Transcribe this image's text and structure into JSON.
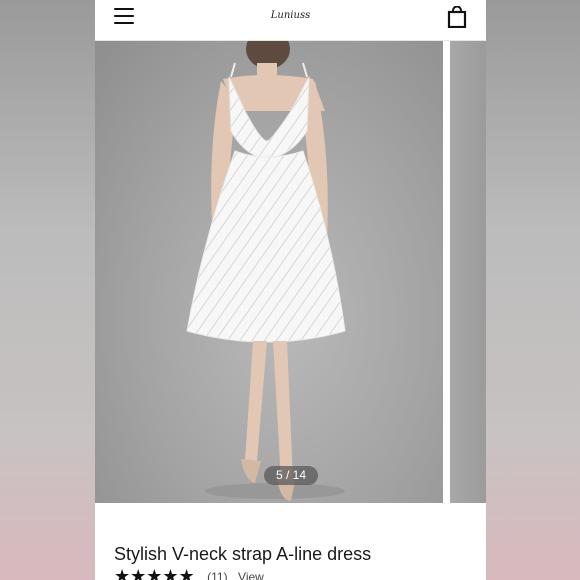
{
  "header": {
    "logo_text": "Luniuss",
    "menu_icon": "hamburger-menu-icon",
    "bag_icon": "shopping-bag-icon"
  },
  "gallery": {
    "counter": "5 / 14"
  },
  "product": {
    "title": "Stylish V-neck strap A-line dress",
    "stars": "★★★★★",
    "review_count": "(11)",
    "view_link": "View"
  },
  "colors": {
    "background": "#ffffff",
    "text": "#1a1a1a",
    "photo_backdrop": "#a3a3a3"
  }
}
